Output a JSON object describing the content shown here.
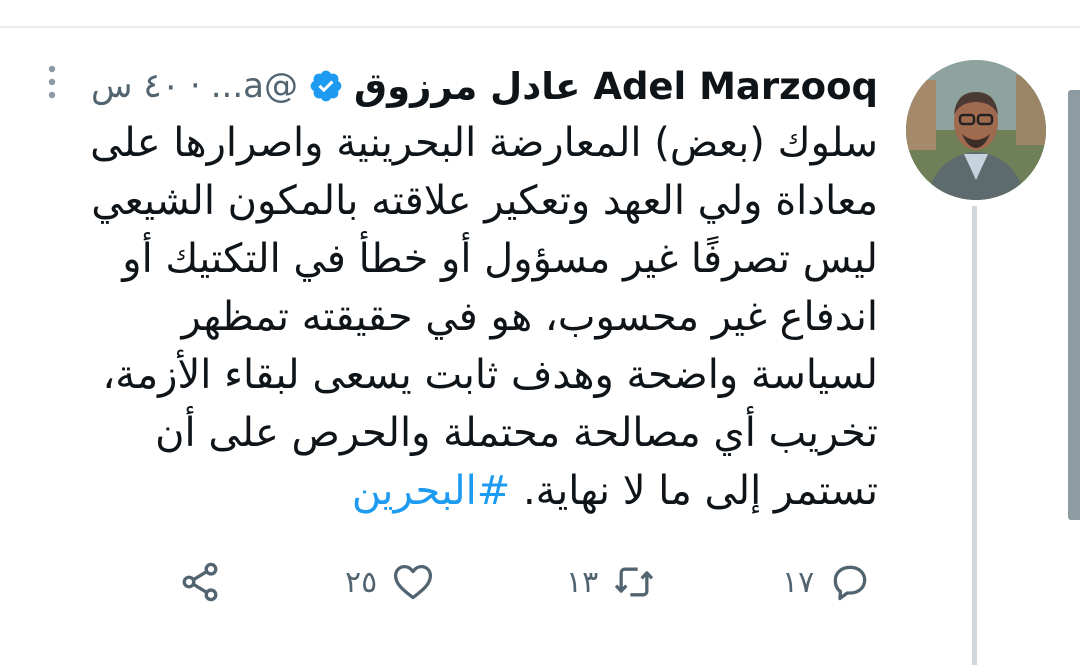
{
  "tweet": {
    "author_name": "Adel Marzooq عادل مرزوق",
    "handle": "@a...",
    "separator": "·",
    "time": "٤٠ س",
    "text": "سلوك (بعض) المعارضة البحرينية واصرارها على معاداة ولي العهد وتعكير علاقته بالمكون الشيعي ليس تصرفًا غير مسؤول أو خطأ في التكتيك أو اندفاع غير محسوب، هو في حقيقته تمظهر لسياسة واضحة وهدف ثابت يسعى لبقاء الأزمة، تخريب أي مصالحة محتملة والحرص على أن تستمر إلى ما لا نهاية.",
    "hashtag": "#البحرين"
  },
  "actions": {
    "reply_count": "١٧",
    "retweet_count": "١٣",
    "like_count": "٢٥"
  },
  "icons": {
    "verified": "verified-badge-icon",
    "more": "more-vertical-icon",
    "reply": "reply-icon",
    "retweet": "retweet-icon",
    "like": "heart-icon",
    "share": "share-icon"
  },
  "colors": {
    "accent": "#1d9bf0",
    "text": "#0f1419",
    "muted": "#536471"
  }
}
